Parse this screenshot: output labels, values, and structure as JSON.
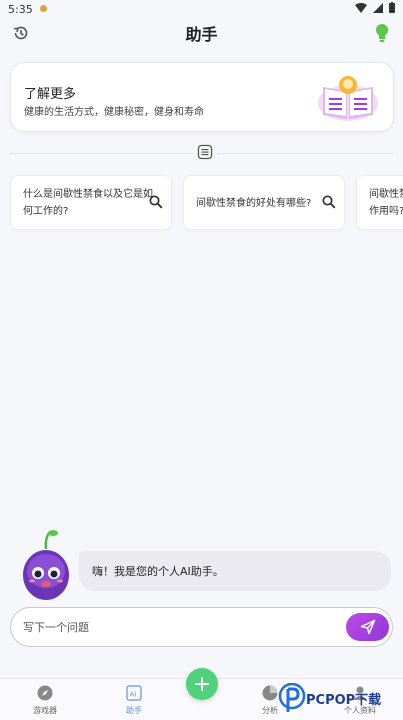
{
  "status_bar": {
    "time": "5:35"
  },
  "header": {
    "title": "助手"
  },
  "learn_card": {
    "title": "了解更多",
    "subtitle": "健康的生活方式，健康秘密，健身和寿命"
  },
  "questions": [
    {
      "line1": "什么是间歇性禁食以及它是如",
      "line2": "何工作的?"
    },
    {
      "line1": "间歇性禁食的好处有哪些?"
    },
    {
      "line1": "间歇性禁",
      "line2": "作用吗?"
    }
  ],
  "chat": {
    "message": "嗨！我是您的个人AI助手。"
  },
  "input": {
    "placeholder": "写下一个问题"
  },
  "nav": {
    "items": [
      {
        "label": "游戏器"
      },
      {
        "label": "助手"
      },
      {
        "label": "分析"
      },
      {
        "label": "个人资料"
      }
    ]
  },
  "watermark": {
    "text": "PCPOP下载"
  },
  "colors": {
    "accent": "#9b3fe0",
    "fab": "#4fd27a",
    "bulb": "#5cc64a",
    "nav_active": "#6b8fe0"
  }
}
